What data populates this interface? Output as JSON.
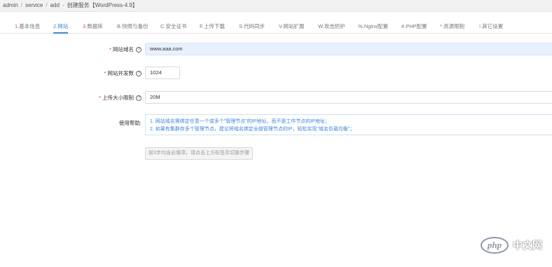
{
  "breadcrumb": {
    "items": [
      "admin",
      "service",
      "add",
      "创建服务【WordPress-4.9】"
    ],
    "separator": "/",
    "dash": "-"
  },
  "tabs": [
    {
      "num": "1.",
      "label": "基本信息"
    },
    {
      "num": "2.",
      "label": "网站"
    },
    {
      "num": "3.",
      "label": "数据库"
    },
    {
      "num": "B.",
      "label": "快照与备份"
    },
    {
      "num": "C.",
      "label": "安全证书"
    },
    {
      "num": "F.",
      "label": "上传下载"
    },
    {
      "num": "S.",
      "label": "代码同步"
    },
    {
      "num": "V.",
      "label": "网站扩展"
    },
    {
      "num": "W.",
      "label": "攻击防护"
    },
    {
      "num": "%.",
      "label": "Nginx配置"
    },
    {
      "num": "#.",
      "label": "PHP配置"
    },
    {
      "num": "*.",
      "label": "资源限制"
    },
    {
      "num": "!.",
      "label": "其它设置"
    }
  ],
  "form": {
    "domain": {
      "required": "*",
      "label": "网站域名",
      "value": "www.aaa.com"
    },
    "concurrency": {
      "required": "*",
      "label": "网站并发数",
      "value": "1024"
    },
    "upload_limit": {
      "required": "*",
      "label": "上传大小限制",
      "value": "20M"
    },
    "help": {
      "label": "使用帮助:",
      "lines": [
        "1. 网站域名需绑定任意一个或多个\"管理节点\"的IP地址，而不是工作节点的IP地址；",
        "2. 如果有集群存多个管理节点，建议将域名绑定全部管理节点的IP，轻松实现\"域名负载均衡\"；"
      ]
    },
    "notice": "前3步均含必填项，请点击上方标签页切换步骤"
  },
  "help_icon_glyph": "?",
  "watermark": {
    "logo": "php",
    "text": "中文网"
  },
  "colors": {
    "accent": "#3a87d8",
    "tab_number": "#e0593a",
    "required": "#e0293a"
  }
}
